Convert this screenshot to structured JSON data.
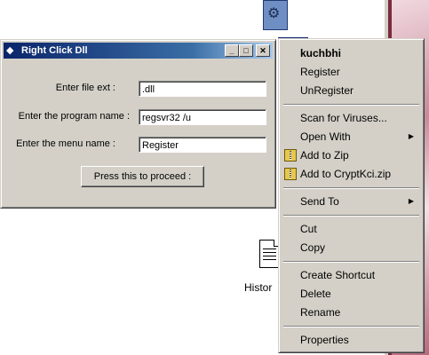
{
  "dialog": {
    "title": "Right Click Dll",
    "fields": [
      {
        "label": "Enter file ext :",
        "value": ".dll"
      },
      {
        "label": "Enter the program name :",
        "value": "regsvr32 /u"
      },
      {
        "label": "Enter the menu name :",
        "value": "Register"
      }
    ],
    "proceed_label": "Press this to proceed  :",
    "min_symbol": "_",
    "max_symbol": "□",
    "close_symbol": "✕"
  },
  "desktop": {
    "history_label": "Histor",
    "partial_left": "",
    "partial_right": ""
  },
  "context_menu": {
    "items": [
      {
        "label": "kuchbhi",
        "bold": true
      },
      {
        "label": "Register"
      },
      {
        "label": "UnRegister"
      },
      {
        "label": "Scan for Viruses..."
      },
      {
        "label": "Open With",
        "submenu": true
      },
      {
        "label": "Add to Zip",
        "icon": "winzip-icon"
      },
      {
        "label": "Add to CryptKci.zip",
        "icon": "winzip-icon"
      },
      {
        "label": "Send To",
        "submenu": true
      },
      {
        "label": "Cut"
      },
      {
        "label": "Copy"
      },
      {
        "label": "Create Shortcut"
      },
      {
        "label": "Delete"
      },
      {
        "label": "Rename"
      },
      {
        "label": "Properties"
      }
    ],
    "submenu_arrow": "▶"
  }
}
